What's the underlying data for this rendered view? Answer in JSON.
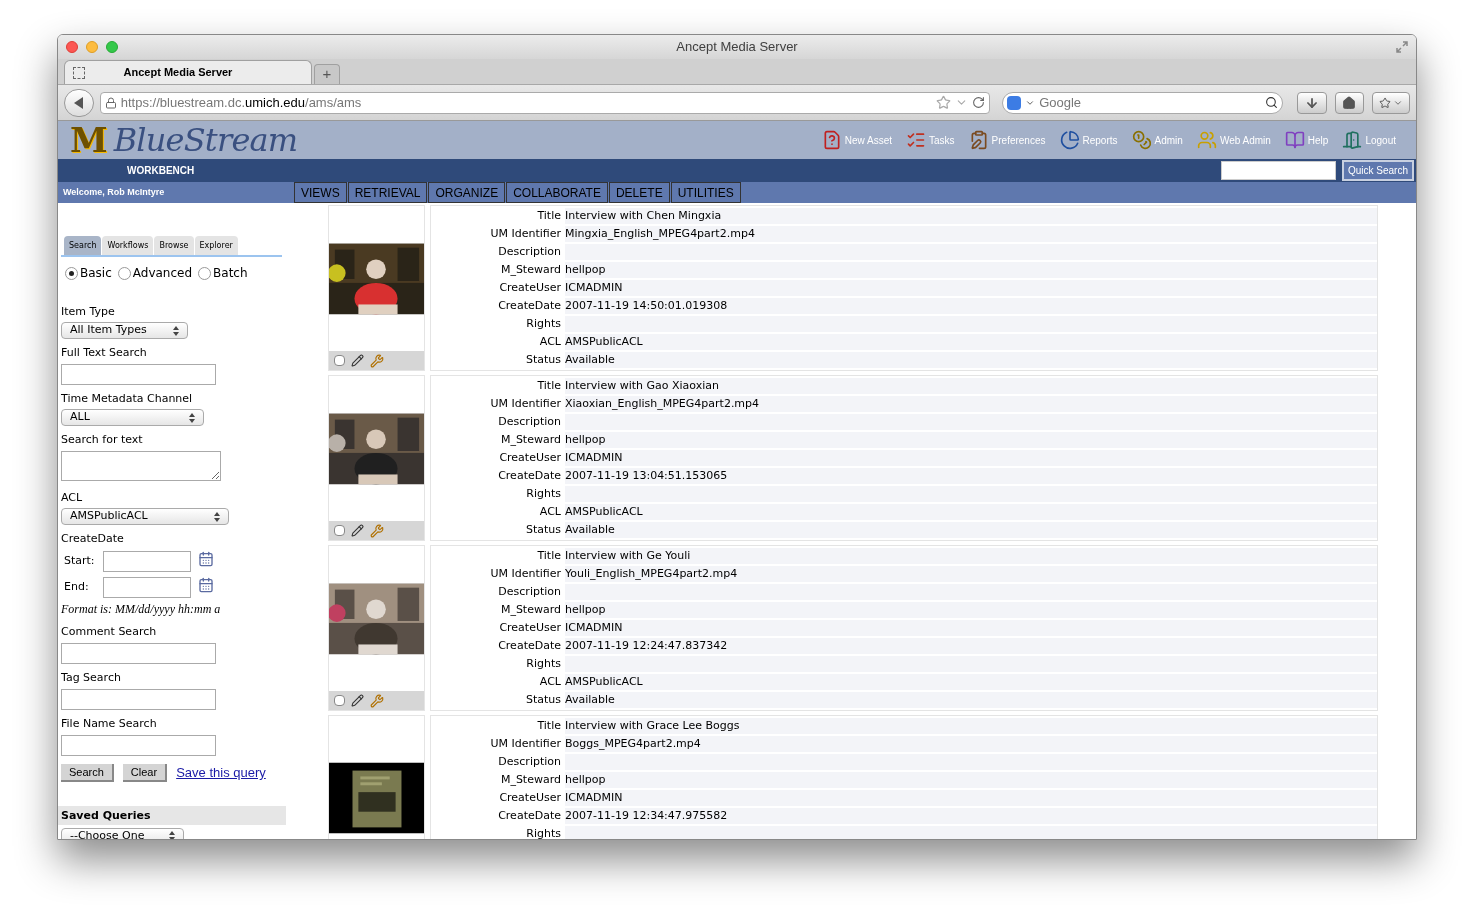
{
  "browser": {
    "title": "Ancept Media Server",
    "tabs": [
      {
        "label": "Ancept Media Server",
        "selected": true
      }
    ],
    "new_tab": "+",
    "url": [
      "https://bluestream.dc.",
      "umich.edu",
      "/ams/ams"
    ],
    "search_placeholder": "Google"
  },
  "header": {
    "logo_mark": "M",
    "logo_text": "BlueStream",
    "links": [
      "New Asset",
      "Tasks",
      "Preferences",
      "Reports",
      "Admin",
      "Web Admin",
      "Help",
      "Logout"
    ],
    "section": "WORKBENCH",
    "quick_search": "Quick Search",
    "welcome": "Welcome, Rob McIntyre",
    "menu": [
      "VIEWS",
      "RETRIEVAL",
      "ORGANIZE",
      "COLLABORATE",
      "DELETE",
      "UTILITIES"
    ]
  },
  "search_panel": {
    "tabs": [
      {
        "label": "Search",
        "selected": true
      },
      {
        "label": "Workflows",
        "selected": false
      },
      {
        "label": "Browse",
        "selected": false
      },
      {
        "label": "Explorer",
        "selected": false
      }
    ],
    "modes": [
      {
        "label": "Basic",
        "selected": true
      },
      {
        "label": "Advanced",
        "selected": false
      },
      {
        "label": "Batch",
        "selected": false
      }
    ],
    "fields": [
      {
        "kind": "select",
        "label": "Item Type",
        "value": "All Item Types"
      },
      {
        "kind": "text",
        "label": "Full Text Search"
      },
      {
        "kind": "select",
        "label": "Time Metadata Channel",
        "value": "ALL"
      },
      {
        "kind": "textarea",
        "label": "Search for text"
      },
      {
        "kind": "select",
        "label": "ACL",
        "value": "AMSPublicACL"
      },
      {
        "kind": "dates",
        "label": "CreateDate",
        "rows": [
          "Start:",
          "End:"
        ],
        "note": "Format is: MM/dd/yyyy hh:mm a"
      },
      {
        "kind": "text",
        "label": "Comment Search"
      },
      {
        "kind": "text",
        "label": "Tag Search"
      },
      {
        "kind": "text",
        "label": "File Name Search"
      }
    ],
    "buttons": [
      "Search",
      "Clear"
    ],
    "link": "Save this query",
    "saved_queries": {
      "title": "Saved Queries",
      "value": "--Choose One"
    }
  },
  "results": [
    {
      "checked": false,
      "fields": [
        {
          "label": "Title",
          "value": "Interview with Chen Mingxia"
        },
        {
          "label": "UM Identifier",
          "value": "Mingxia_English_MPEG4part2.mp4"
        },
        {
          "label": "Description"
        },
        {
          "label": "M_Steward",
          "value": "hellpop"
        },
        {
          "label": "CreateUser",
          "value": "ICMADMIN"
        },
        {
          "label": "CreateDate",
          "value": "2007-11-19 14:50:01.019308"
        },
        {
          "label": "Rights"
        },
        {
          "label": "ACL",
          "value": "AMSPublicACL"
        },
        {
          "label": "Status",
          "value": "Available"
        }
      ]
    },
    {
      "checked": false,
      "fields": [
        {
          "label": "Title",
          "value": "Interview with Gao Xiaoxian"
        },
        {
          "label": "UM Identifier",
          "value": "Xiaoxian_English_MPEG4part2.mp4"
        },
        {
          "label": "Description"
        },
        {
          "label": "M_Steward",
          "value": "hellpop"
        },
        {
          "label": "CreateUser",
          "value": "ICMADMIN"
        },
        {
          "label": "CreateDate",
          "value": "2007-11-19 13:04:51.153065"
        },
        {
          "label": "Rights"
        },
        {
          "label": "ACL",
          "value": "AMSPublicACL"
        },
        {
          "label": "Status",
          "value": "Available"
        }
      ]
    },
    {
      "checked": false,
      "fields": [
        {
          "label": "Title",
          "value": "Interview with Ge Youli"
        },
        {
          "label": "UM Identifier",
          "value": "Youli_English_MPEG4part2.mp4"
        },
        {
          "label": "Description"
        },
        {
          "label": "M_Steward",
          "value": "hellpop"
        },
        {
          "label": "CreateUser",
          "value": "ICMADMIN"
        },
        {
          "label": "CreateDate",
          "value": "2007-11-19 12:24:47.837342"
        },
        {
          "label": "Rights"
        },
        {
          "label": "ACL",
          "value": "AMSPublicACL"
        },
        {
          "label": "Status",
          "value": "Available"
        }
      ]
    },
    {
      "fields": [
        {
          "label": "Title",
          "value": "Interview with Grace Lee Boggs"
        },
        {
          "label": "UM Identifier",
          "value": "Boggs_MPEG4part2.mp4"
        },
        {
          "label": "Description"
        },
        {
          "label": "M_Steward",
          "value": "hellpop"
        },
        {
          "label": "CreateUser",
          "value": "ICMADMIN"
        },
        {
          "label": "CreateDate",
          "value": "2007-11-19 12:34:47.975582"
        },
        {
          "label": "Rights"
        }
      ]
    }
  ]
}
